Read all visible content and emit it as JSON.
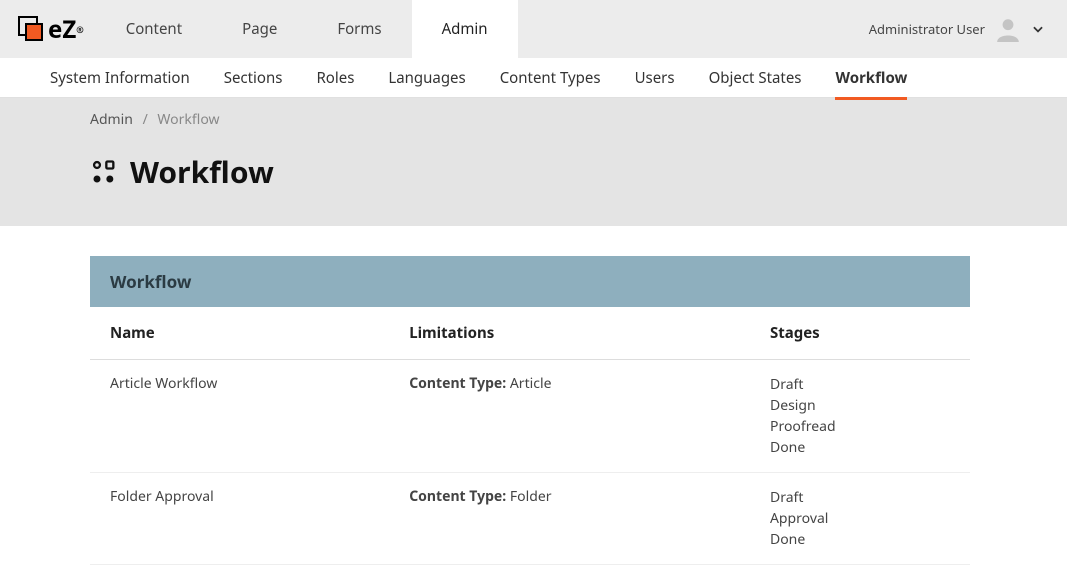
{
  "brand": "eZ",
  "topnav": [
    "Content",
    "Page",
    "Forms",
    "Admin"
  ],
  "topnav_active": 3,
  "user": {
    "name": "Administrator User"
  },
  "subnav": [
    "System Information",
    "Sections",
    "Roles",
    "Languages",
    "Content Types",
    "Users",
    "Object States",
    "Workflow"
  ],
  "subnav_active": 7,
  "breadcrumb": {
    "root": "Admin",
    "current": "Workflow"
  },
  "page_title": "Workflow",
  "panel_title": "Workflow",
  "columns": {
    "name": "Name",
    "limitations": "Limitations",
    "stages": "Stages"
  },
  "limit_label": "Content Type:",
  "rows": [
    {
      "name": "Article Workflow",
      "limitation_value": "Article",
      "stages": [
        "Draft",
        "Design",
        "Proofread",
        "Done"
      ]
    },
    {
      "name": "Folder Approval",
      "limitation_value": "Folder",
      "stages": [
        "Draft",
        "Approval",
        "Done"
      ]
    }
  ]
}
